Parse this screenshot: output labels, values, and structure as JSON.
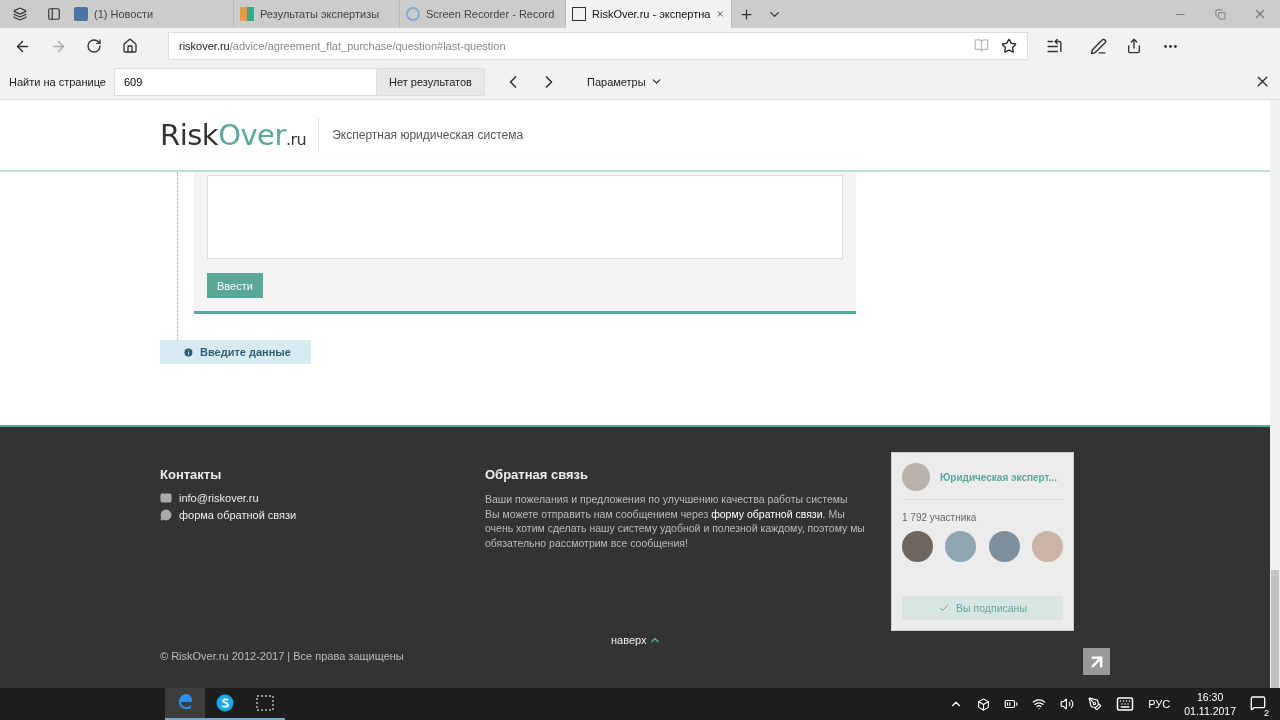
{
  "browser": {
    "tabs": [
      {
        "label": "(1) Новости",
        "kind": "vk",
        "selected": false
      },
      {
        "label": "Результаты экспертизы",
        "kind": "tiles",
        "selected": false
      },
      {
        "label": "Screen Recorder - Record",
        "kind": "recorder",
        "selected": false
      },
      {
        "label": "RiskOver.ru - экспертна",
        "kind": "page",
        "selected": true
      }
    ],
    "address": {
      "host": "riskover.ru",
      "path": "/advice/agreement_flat_purchase/question#last-question"
    },
    "find_bar": {
      "label": "Найти на странице",
      "value": "609",
      "result": "Нет результатов",
      "options": "Параметры"
    }
  },
  "page": {
    "header": {
      "logo_main": "Risk",
      "logo_accent": "Over",
      "logo_suffix": ".ru",
      "tagline": "Экспертная юридическая система"
    },
    "form": {
      "submit": "Ввести"
    },
    "notice": "Введите данные",
    "footer": {
      "contacts": {
        "title": "Контакты",
        "items": [
          {
            "kind": "mail",
            "text": "info@riskover.ru"
          },
          {
            "kind": "chat",
            "text": "форма обратной связи"
          }
        ]
      },
      "feedback": {
        "title": "Обратная связь",
        "text_before": "Ваши пожелания и предложения по улучшению качества работы системы Вы можете отправить нам сообщением через ",
        "link": "форму обратной связи",
        "text_after": ". Мы очень хотим сделать нашу систему удобной и полезной каждому, поэтому мы обязательно рассмотрим все сообщения!"
      },
      "widget": {
        "name": "Юридическая эксперт...",
        "members": "1 792 участника",
        "button": "Вы подписаны",
        "subscribed": true
      },
      "to_top": "наверх",
      "copyright": "© RiskOver.ru 2012-2017 | Все права защищены"
    }
  },
  "taskbar": {
    "apps": [
      {
        "kind": "edge",
        "selected": true
      },
      {
        "kind": "skype",
        "selected": false
      },
      {
        "kind": "snip",
        "selected": false
      }
    ],
    "language": "РУС",
    "time": "16:30",
    "date": "01.11.2017",
    "notifications": "2"
  }
}
